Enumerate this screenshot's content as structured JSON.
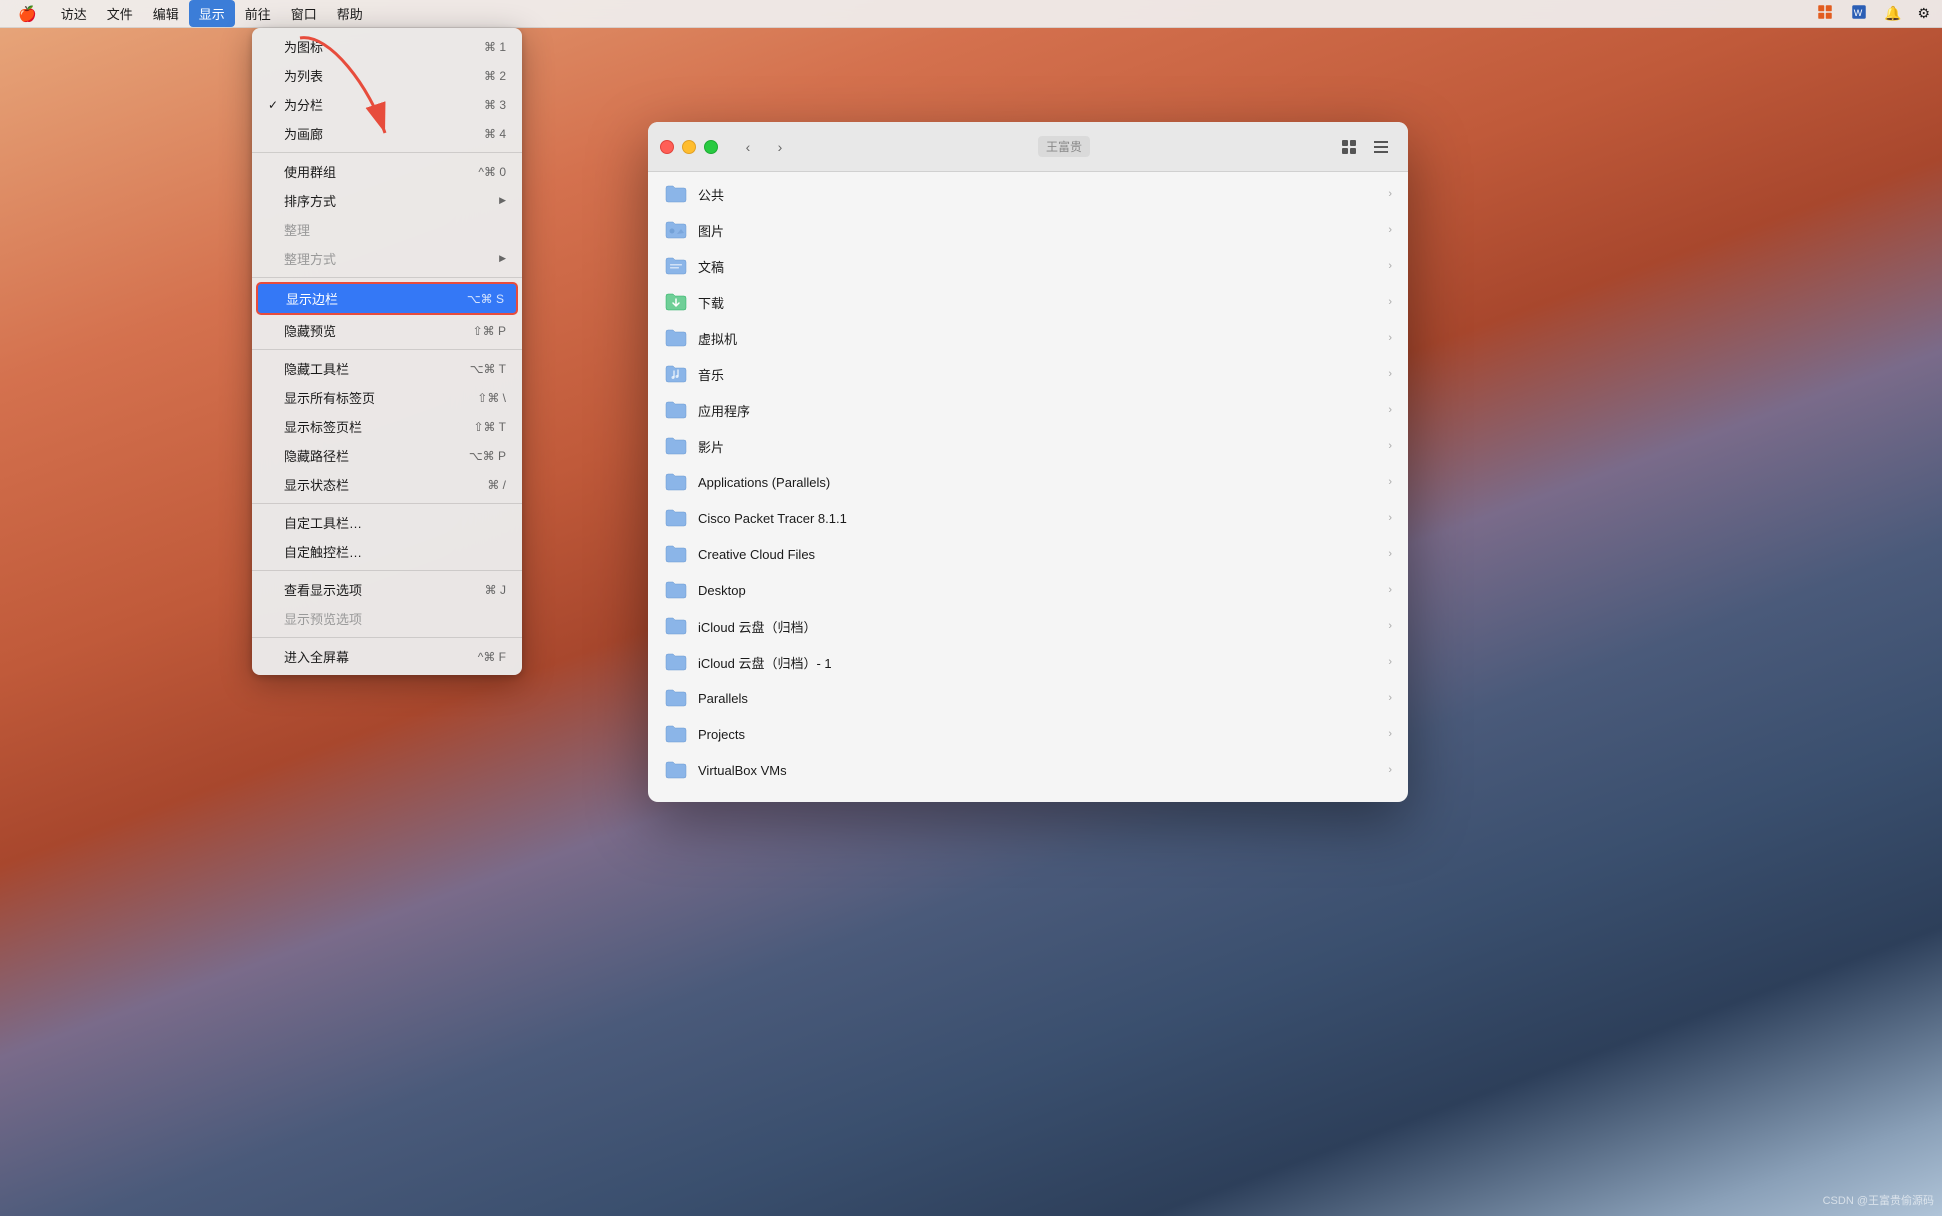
{
  "menubar": {
    "apple": "🍎",
    "items": [
      {
        "id": "finder",
        "label": "访达"
      },
      {
        "id": "file",
        "label": "文件"
      },
      {
        "id": "edit",
        "label": "编辑"
      },
      {
        "id": "view",
        "label": "显示",
        "active": true
      },
      {
        "id": "go",
        "label": "前往"
      },
      {
        "id": "window",
        "label": "窗口"
      },
      {
        "id": "help",
        "label": "帮助"
      }
    ],
    "right_icons": [
      "cc-icon",
      "word-icon",
      "bell-icon",
      "system-icon"
    ]
  },
  "dropdown": {
    "items": [
      {
        "id": "as-icons",
        "label": "为图标",
        "shortcut": "⌘ 1",
        "check": false
      },
      {
        "id": "as-list",
        "label": "为列表",
        "shortcut": "⌘ 2",
        "check": false
      },
      {
        "id": "as-columns",
        "label": "为分栏",
        "shortcut": "⌘ 3",
        "check": true
      },
      {
        "id": "as-gallery",
        "label": "为画廊",
        "shortcut": "⌘ 4",
        "check": false
      },
      {
        "separator": true
      },
      {
        "id": "use-groups",
        "label": "使用群组",
        "shortcut": "^⌘ 0",
        "check": false
      },
      {
        "id": "sort-by",
        "label": "排序方式",
        "shortcut": "",
        "check": false,
        "submenu": true
      },
      {
        "id": "clean-up",
        "label": "整理",
        "shortcut": "",
        "check": false,
        "disabled": true
      },
      {
        "id": "clean-up-by",
        "label": "整理方式",
        "shortcut": "",
        "check": false,
        "submenu": true,
        "disabled": true
      },
      {
        "separator": true
      },
      {
        "id": "show-sidebar",
        "label": "显示边栏",
        "shortcut": "⌥⌘ S",
        "check": false,
        "highlighted_box": true
      },
      {
        "id": "hide-preview",
        "label": "隐藏预览",
        "shortcut": "⇧⌘ P",
        "check": false
      },
      {
        "separator": true
      },
      {
        "id": "hide-toolbar",
        "label": "隐藏工具栏",
        "shortcut": "⌥⌘ T",
        "check": false
      },
      {
        "id": "show-all-tabs",
        "label": "显示所有标签页",
        "shortcut": "⇧⌘ \\",
        "check": false
      },
      {
        "id": "show-tab-bar",
        "label": "显示标签页栏",
        "shortcut": "⇧⌘ T",
        "check": false
      },
      {
        "id": "hide-path-bar",
        "label": "隐藏路径栏",
        "shortcut": "⌥⌘ P",
        "check": false
      },
      {
        "id": "show-status-bar",
        "label": "显示状态栏",
        "shortcut": "⌘ /",
        "check": false
      },
      {
        "separator": true
      },
      {
        "id": "customize-toolbar",
        "label": "自定工具栏…",
        "shortcut": "",
        "check": false
      },
      {
        "id": "customize-touch-bar",
        "label": "自定触控栏…",
        "shortcut": "",
        "check": false
      },
      {
        "separator": true
      },
      {
        "id": "view-options",
        "label": "查看显示选项",
        "shortcut": "⌘ J",
        "check": false
      },
      {
        "id": "preview-options",
        "label": "显示预览选项",
        "shortcut": "",
        "check": false,
        "disabled": true
      },
      {
        "separator": true
      },
      {
        "id": "enter-fullscreen",
        "label": "进入全屏幕",
        "shortcut": "^⌘ F",
        "check": false
      }
    ]
  },
  "finder": {
    "title": "王富贵",
    "folders": [
      {
        "name": "公共",
        "icon": "folder-public"
      },
      {
        "name": "图片",
        "icon": "folder-pictures"
      },
      {
        "name": "文稿",
        "icon": "folder-docs"
      },
      {
        "name": "下载",
        "icon": "folder-downloads"
      },
      {
        "name": "虚拟机",
        "icon": "folder-vm"
      },
      {
        "name": "音乐",
        "icon": "folder-music"
      },
      {
        "name": "应用程序",
        "icon": "folder-apps"
      },
      {
        "name": "影片",
        "icon": "folder-movies"
      },
      {
        "name": "Applications (Parallels)",
        "icon": "folder-parallels"
      },
      {
        "name": "Cisco Packet Tracer 8.1.1",
        "icon": "folder-cisco"
      },
      {
        "name": "Creative Cloud Files",
        "icon": "folder-cc"
      },
      {
        "name": "Desktop",
        "icon": "folder-desktop"
      },
      {
        "name": "iCloud 云盘（归档）",
        "icon": "folder-icloud"
      },
      {
        "name": "iCloud 云盘（归档）- 1",
        "icon": "folder-icloud2"
      },
      {
        "name": "Parallels",
        "icon": "folder-parallels2"
      },
      {
        "name": "Projects",
        "icon": "folder-projects"
      },
      {
        "name": "VirtualBox VMs",
        "icon": "folder-vbox"
      }
    ]
  },
  "watermark": {
    "text": "CSDN @王富贵偷源码"
  }
}
